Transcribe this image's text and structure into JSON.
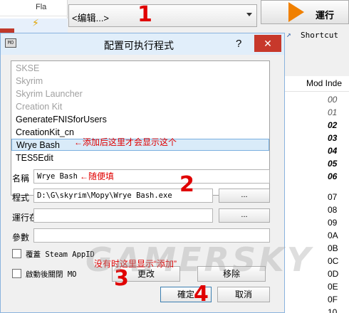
{
  "background": {
    "plugin_column_header": "Fla",
    "executable_combo": "<编辑...>",
    "run_button": "運行",
    "shortcut_button": "Shortcut",
    "mod_index_header": "Mod Inde",
    "mod_indices": [
      "00",
      "01",
      "02",
      "03",
      "04",
      "05",
      "06",
      "07",
      "08",
      "09",
      "0A",
      "0B",
      "0C",
      "0D",
      "0E",
      "0F",
      "10"
    ]
  },
  "dialog": {
    "title": "配置可执行程式",
    "help": "?",
    "close": "✕",
    "app_icon": "MO",
    "executables": [
      "SKSE",
      "Skyrim",
      "Skyrim Launcher",
      "Creation Kit",
      "GenerateFNISforUsers",
      "CreationKit_cn",
      "Wrye Bash",
      "TES5Edit"
    ],
    "selected_index": 6,
    "name_label": "名稱",
    "name_value": "Wrye Bash",
    "binary_label": "程式",
    "binary_value": "D:\\G\\skyrim\\Mopy\\Wrye Bash.exe",
    "binary_browse": "...",
    "start_in_label": "運行在",
    "start_in_value": "",
    "start_in_browse": "...",
    "arguments_label": "參數",
    "arguments_value": "",
    "override_steam_label": "覆蓋 Steam AppID",
    "override_steam_checked": false,
    "close_mo_label": "啟動後關閉 MO",
    "close_mo_checked": false,
    "modify_button": "更改",
    "remove_button": "移除",
    "ok_button": "確定",
    "cancel_button": "取消"
  },
  "annotations": {
    "n1": "1",
    "n2": "2",
    "n3": "3",
    "n4": "4",
    "list_note": "←添加后这里才会显示这个",
    "name_note": "←随便填",
    "modify_note": "没有时这里显示“添加”",
    "watermark": "GAMERSKY"
  },
  "colors": {
    "annotation_red": "#e00000",
    "close_red": "#c7382b",
    "selection_blue": "#d9ebf9",
    "run_orange": "#f08000"
  }
}
